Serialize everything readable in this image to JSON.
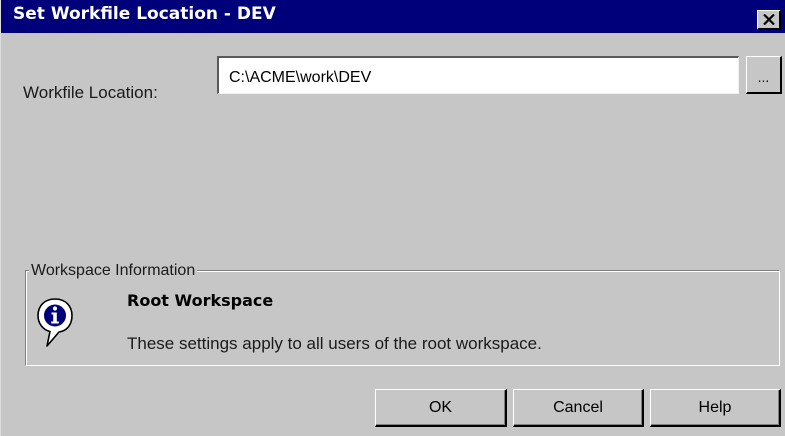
{
  "window": {
    "title": "Set Workfile Location - DEV"
  },
  "titlebar": {
    "close_icon": "close-icon",
    "background": "#00007b"
  },
  "location": {
    "label": "Workfile Location:",
    "value": "C:\\ACME\\work\\DEV",
    "browse_label": "..."
  },
  "workspace_info": {
    "group_label": "Workspace Information",
    "icon": "info-icon",
    "title": "Root Workspace",
    "description": "These settings apply to all users of the root workspace."
  },
  "buttons": {
    "ok": "OK",
    "cancel": "Cancel",
    "help": "Help"
  }
}
